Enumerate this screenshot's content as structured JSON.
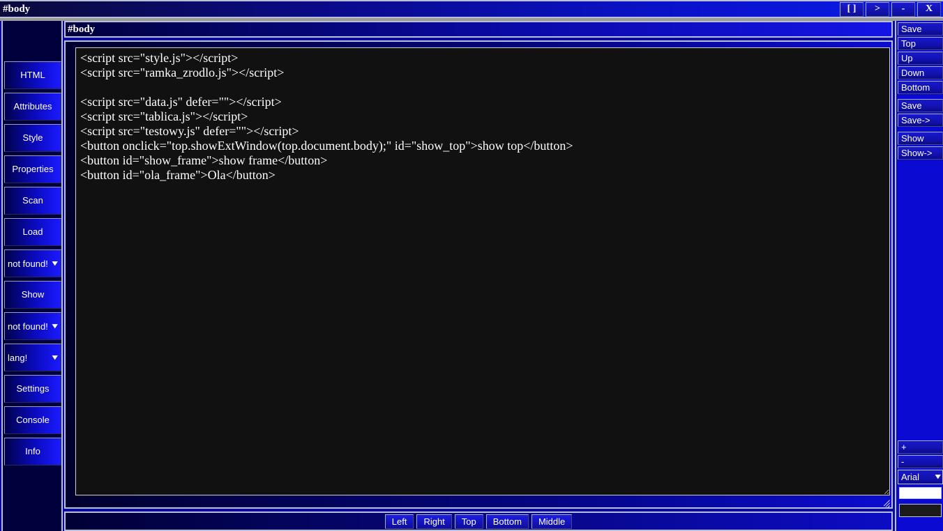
{
  "titlebar": {
    "title": "#body",
    "buttons": [
      {
        "label": "[ ]",
        "name": "restore-button"
      },
      {
        "label": ">",
        "name": "expand-button"
      },
      {
        "label": "-",
        "name": "minimize-button"
      },
      {
        "label": "X",
        "name": "close-button"
      }
    ]
  },
  "sidebar_left": {
    "items": [
      {
        "type": "button",
        "label": "HTML"
      },
      {
        "type": "button",
        "label": "Attributes"
      },
      {
        "type": "button",
        "label": "Style"
      },
      {
        "type": "button",
        "label": "Properties"
      },
      {
        "type": "button",
        "label": "Scan"
      },
      {
        "type": "button",
        "label": "Load"
      },
      {
        "type": "select",
        "label": "not found!"
      },
      {
        "type": "button",
        "label": "Show"
      },
      {
        "type": "select",
        "label": "not found!"
      },
      {
        "type": "select",
        "label": "lang!"
      },
      {
        "type": "button",
        "label": "Settings"
      },
      {
        "type": "button",
        "label": "Console"
      },
      {
        "type": "button",
        "label": "Info"
      }
    ]
  },
  "center": {
    "path": "#body",
    "code": "<script src=\"style.js\"></script>\n<script src=\"ramka_zrodlo.js\"></script>\n\n<script src=\"data.js\" defer=\"\"></script>\n<script src=\"tablica.js\"></script>\n<script src=\"testowy.js\" defer=\"\"></script>\n<button onclick=\"top.showExtWindow(top.document.body);\" id=\"show_top\">show top</button>\n<button id=\"show_frame\">show frame</button>\n<button id=\"ola_frame\">Ola</button>"
  },
  "bottom_bar": {
    "buttons": [
      "Left",
      "Right",
      "Top",
      "Bottom",
      "Middle"
    ]
  },
  "sidebar_right": {
    "group1": [
      "Save"
    ],
    "group2": [
      "Top",
      "Up",
      "Down",
      "Bottom"
    ],
    "group3": [
      "Save",
      "Save->"
    ],
    "group4": [
      "Show",
      "Show->"
    ],
    "zoom_in": "+",
    "zoom_out": "-",
    "font_select": "Arial",
    "text_input": "",
    "dark_input": ""
  },
  "colors": {
    "accent_blue": "#1a1aff",
    "dark_navy": "#00003c",
    "frame_border": "#b9bfd6",
    "editor_bg": "#111111",
    "text": "#ffffff"
  }
}
